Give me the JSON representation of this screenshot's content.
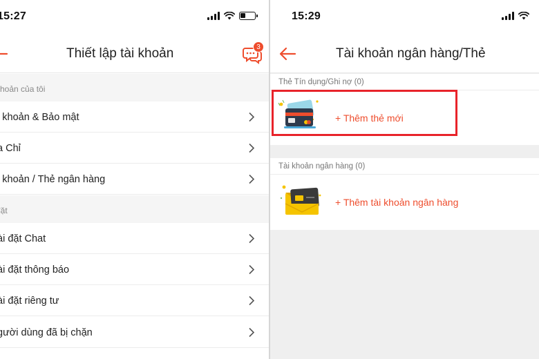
{
  "left_screen": {
    "status": {
      "time": "15:27"
    },
    "header": {
      "title": "Thiết lập tài khoản",
      "chat_badge": "3"
    },
    "sections": [
      {
        "title": "khoản của tôi",
        "items": [
          {
            "label": "i khoản & Bảo mật"
          },
          {
            "label": "a Chỉ"
          },
          {
            "label": "i khoản / Thẻ ngân hàng"
          }
        ]
      },
      {
        "title": "đặt",
        "items": [
          {
            "label": "ài đặt Chat"
          },
          {
            "label": "ài đặt thông báo"
          },
          {
            "label": "ài đặt riêng tư"
          },
          {
            "label": "gười dùng đã bị chặn"
          }
        ]
      }
    ]
  },
  "right_screen": {
    "status": {
      "time": "15:29"
    },
    "header": {
      "title": "Tài khoản ngân hàng/Thẻ"
    },
    "card_section": {
      "label": "Thẻ Tín dụng/Ghi nợ (0)",
      "add_label": "+ Thêm thẻ mới"
    },
    "bank_section": {
      "label": "Tài khoản ngân hàng (0)",
      "add_label": "+ Thêm tài khoản ngân hàng"
    }
  },
  "colors": {
    "accent": "#ee4d2d",
    "highlight_box": "#e8232a",
    "section_bg": "#f5f5f5",
    "page_bg": "#efefef"
  },
  "icons": {
    "back": "arrow-left-icon",
    "chat": "chat-bubble-icon",
    "chevron": "chevron-right-icon",
    "card_illustration": "credit-card-illustration",
    "bank_illustration": "bank-card-illustration"
  }
}
